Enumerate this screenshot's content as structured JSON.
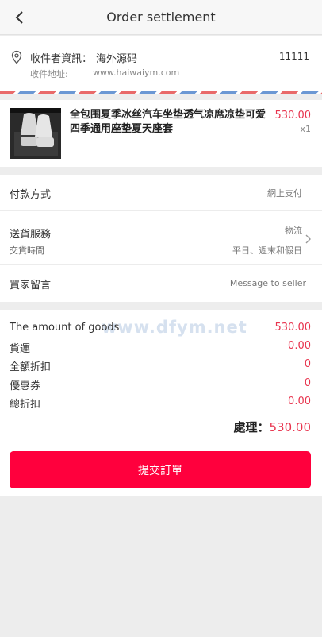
{
  "header": {
    "title": "Order settlement",
    "back_icon": "chevron-left-icon"
  },
  "address": {
    "icon": "location-pin-icon",
    "name_label": "收件者資訊：",
    "name": "海外源码",
    "phone": "11111",
    "address_label": "收件地址:",
    "address": "www.haiwaiym.com"
  },
  "product": {
    "image": "car-seat-cushion",
    "name": "全包围夏季冰丝汽车坐垫透气凉席凉垫可爱四季通用座垫夏天座套",
    "price": "530.00",
    "quantity": "x1"
  },
  "options": {
    "payment_label": "付款方式",
    "payment_value": "網上支付",
    "delivery_label": "送貨服務",
    "delivery_value": "物流",
    "delivery_time_label": "交貨時間",
    "delivery_time_value": "平日、週末和假日",
    "message_label": "買家留言",
    "message_placeholder": "Message to seller"
  },
  "summary": {
    "watermark": "www.dfym.net",
    "rows": [
      {
        "label": "The amount of goods",
        "value": "530.00"
      },
      {
        "label": "貨運",
        "value": "0.00"
      },
      {
        "label": "全額折扣",
        "value": "0"
      },
      {
        "label": "優惠券",
        "value": "0"
      },
      {
        "label": "總折扣",
        "value": "0.00"
      }
    ],
    "total_label": "處理：",
    "total_value": "530.00"
  },
  "actions": {
    "submit_label": "提交訂單"
  },
  "colors": {
    "accent": "#ff003d",
    "price": "#e8344e",
    "background": "#ededed"
  }
}
